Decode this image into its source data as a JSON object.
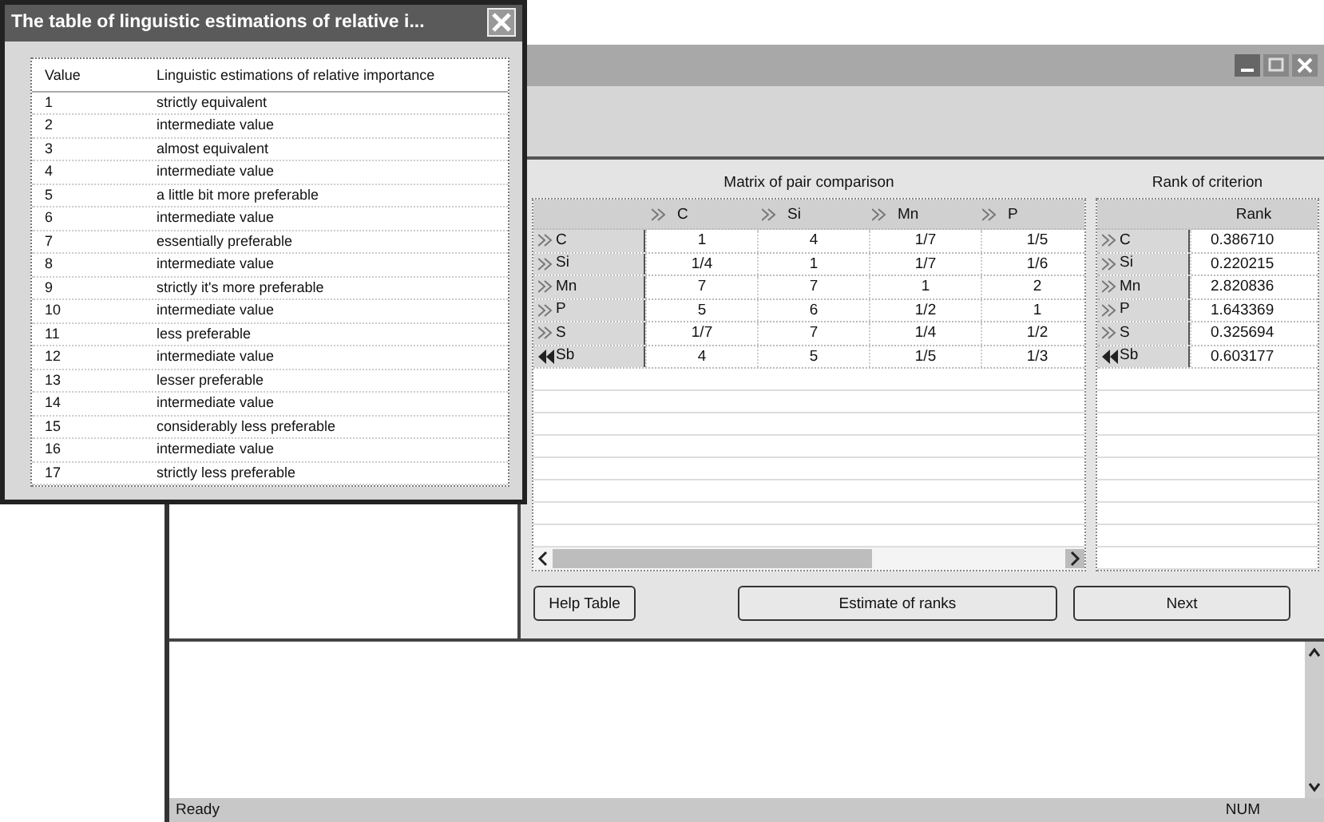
{
  "main_window": {
    "matrix": {
      "caption": "Matrix of pair comparison",
      "columns": [
        "C",
        "Si",
        "Mn",
        "P"
      ],
      "rows": [
        {
          "name": "C",
          "selected": false,
          "cells": [
            "1",
            "4",
            "1/7",
            "1/5"
          ]
        },
        {
          "name": "Si",
          "selected": false,
          "cells": [
            "1/4",
            "1",
            "1/7",
            "1/6"
          ]
        },
        {
          "name": "Mn",
          "selected": false,
          "cells": [
            "7",
            "7",
            "1",
            "2"
          ]
        },
        {
          "name": "P",
          "selected": false,
          "cells": [
            "5",
            "6",
            "1/2",
            "1"
          ]
        },
        {
          "name": "S",
          "selected": false,
          "cells": [
            "1/7",
            "7",
            "1/4",
            "1/2"
          ]
        },
        {
          "name": "Sb",
          "selected": true,
          "cells": [
            "4",
            "5",
            "1/5",
            "1/3"
          ]
        }
      ]
    },
    "rank": {
      "caption": "Rank of criterion",
      "column": "Rank",
      "rows": [
        {
          "name": "C",
          "selected": false,
          "value": "0.386710"
        },
        {
          "name": "Si",
          "selected": false,
          "value": "0.220215"
        },
        {
          "name": "Mn",
          "selected": false,
          "value": "2.820836"
        },
        {
          "name": "P",
          "selected": false,
          "value": "1.643369"
        },
        {
          "name": "S",
          "selected": false,
          "value": "0.325694"
        },
        {
          "name": "Sb",
          "selected": true,
          "value": "0.603177"
        }
      ]
    },
    "buttons": {
      "help": "Help Table",
      "estimate": "Estimate of ranks",
      "next": "Next"
    },
    "status_bar": {
      "left": "Ready",
      "right": "NUM"
    }
  },
  "dialog": {
    "title": "The table of linguistic estimations of relative i...",
    "columns": [
      "Value",
      "Linguistic estimations of relative importance"
    ],
    "rows": [
      [
        "1",
        "strictly equivalent"
      ],
      [
        "2",
        "intermediate value"
      ],
      [
        "3",
        "almost equivalent"
      ],
      [
        "4",
        "intermediate value"
      ],
      [
        "5",
        "a little bit more preferable"
      ],
      [
        "6",
        "intermediate value"
      ],
      [
        "7",
        "essentially preferable"
      ],
      [
        "8",
        "intermediate value"
      ],
      [
        "9",
        "strictly it's more preferable"
      ],
      [
        "10",
        "intermediate value"
      ],
      [
        "11",
        "less preferable"
      ],
      [
        "12",
        "intermediate value"
      ],
      [
        "13",
        "lesser preferable"
      ],
      [
        "14",
        "intermediate value"
      ],
      [
        "15",
        "considerably less preferable"
      ],
      [
        "16",
        "intermediate value"
      ],
      [
        "17",
        "strictly less preferable"
      ]
    ]
  }
}
